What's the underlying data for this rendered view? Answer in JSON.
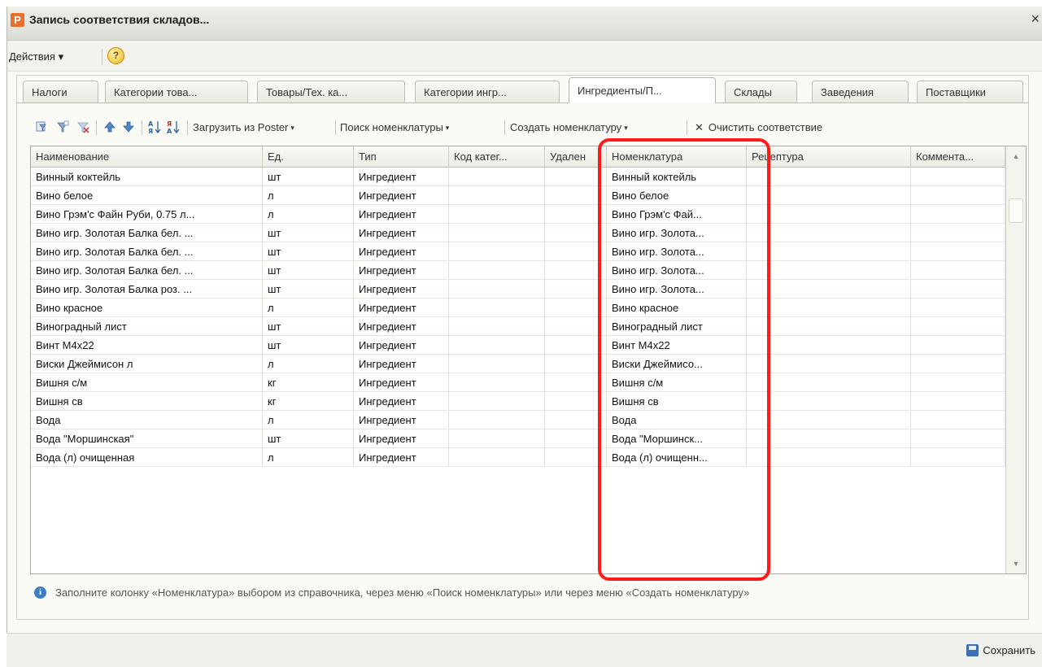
{
  "window": {
    "title": "Запись соответствия складов...",
    "app_icon_letter": "Р",
    "close_glyph": "×"
  },
  "menubar": {
    "actions_label": "Действия ▾",
    "help_glyph": "?"
  },
  "tabs": [
    {
      "label": "Налоги",
      "active": false
    },
    {
      "label": "Категории това...",
      "active": false
    },
    {
      "label": "Товары/Тех. ка...",
      "active": false
    },
    {
      "label": "Категории ингр...",
      "active": false
    },
    {
      "label": "Ингредиенты/П...",
      "active": true
    },
    {
      "label": "Склады",
      "active": false
    },
    {
      "label": "Заведения",
      "active": false
    },
    {
      "label": "Поставщики",
      "active": false
    }
  ],
  "toolbar": {
    "icons": [
      "filter-set-icon",
      "filter-by-value-icon",
      "filter-clear-icon",
      "move-up-icon",
      "move-down-icon",
      "sort-asc-icon",
      "sort-desc-icon"
    ],
    "load_label": "Загрузить из Poster",
    "search_label": "Поиск номенклатуры",
    "create_label": "Создать номенклатуру",
    "clear_label": "Очистить соответствие",
    "clear_glyph": "✕",
    "dropdown_glyph": "▾"
  },
  "table": {
    "columns": [
      "Наименование",
      "Ед.",
      "Тип",
      "Код катег...",
      "Удален",
      "Номенклатура",
      "Рецептура",
      "Коммента..."
    ],
    "rows": [
      [
        "Винный коктейль",
        "шт",
        "Ингредиент",
        "",
        "",
        "Винный коктейль",
        "",
        ""
      ],
      [
        "Вино белое",
        "л",
        "Ингредиент",
        "",
        "",
        "Вино белое",
        "",
        ""
      ],
      [
        "Вино Грэм'с Файн Руби, 0.75 л...",
        "л",
        "Ингредиент",
        "",
        "",
        "Вино Грэм'с Фай...",
        "",
        ""
      ],
      [
        "Вино игр. Золотая Балка бел. ...",
        "шт",
        "Ингредиент",
        "",
        "",
        "Вино игр. Золота...",
        "",
        ""
      ],
      [
        "Вино игр. Золотая Балка бел. ...",
        "шт",
        "Ингредиент",
        "",
        "",
        "Вино игр. Золота...",
        "",
        ""
      ],
      [
        "Вино игр. Золотая Балка бел. ...",
        "шт",
        "Ингредиент",
        "",
        "",
        "Вино игр. Золота...",
        "",
        ""
      ],
      [
        "Вино игр. Золотая Балка роз. ...",
        "шт",
        "Ингредиент",
        "",
        "",
        "Вино игр. Золота...",
        "",
        ""
      ],
      [
        "Вино красное",
        "л",
        "Ингредиент",
        "",
        "",
        "Вино красное",
        "",
        ""
      ],
      [
        "Виноградный лист",
        "шт",
        "Ингредиент",
        "",
        "",
        "Виноградный лист",
        "",
        ""
      ],
      [
        "Винт М4х22",
        "шт",
        "Ингредиент",
        "",
        "",
        "Винт М4х22",
        "",
        ""
      ],
      [
        "Виски Джеймисон л",
        "л",
        "Ингредиент",
        "",
        "",
        "Виски Джеймисо...",
        "",
        ""
      ],
      [
        "Вишня с/м",
        "кг",
        "Ингредиент",
        "",
        "",
        "Вишня с/м",
        "",
        ""
      ],
      [
        "Вишня св",
        "кг",
        "Ингредиент",
        "",
        "",
        "Вишня св",
        "",
        ""
      ],
      [
        "Вода",
        "л",
        "Ингредиент",
        "",
        "",
        "Вода",
        "",
        ""
      ],
      [
        "Вода \"Моршинская\"",
        "шт",
        "Ингредиент",
        "",
        "",
        "Вода \"Моршинск...",
        "",
        ""
      ],
      [
        "Вода (л) очищенная",
        "л",
        "Ингредиент",
        "",
        "",
        "Вода (л) очищенн...",
        "",
        ""
      ]
    ],
    "scroll_up_glyph": "▲",
    "scroll_down_glyph": "▼"
  },
  "hint": {
    "icon_glyph": "i",
    "text": "Заполните колонку «Номенклатура» выбором из справочника, через меню «Поиск номенклатуры» или через меню «Создать номенклатуру»"
  },
  "footer": {
    "save_label": "Сохранить"
  },
  "colors": {
    "highlight": "#ff1a1a",
    "accent": "#3a7fc4"
  }
}
